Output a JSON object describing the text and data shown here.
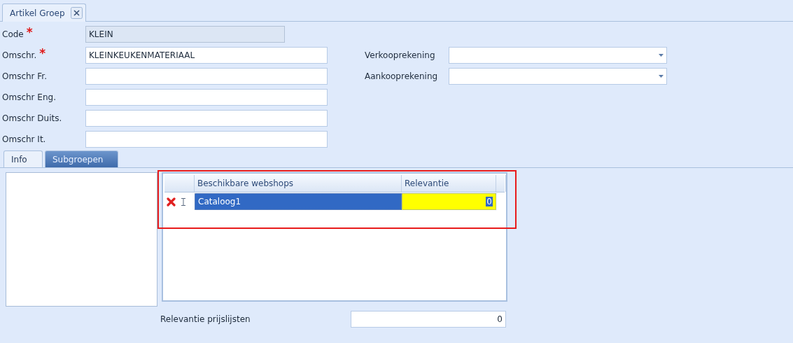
{
  "document_tab": {
    "title": "Artikel Groep",
    "selected": true
  },
  "fields": [
    {
      "label": "Code",
      "required_mark": "*",
      "value": "KLEIN",
      "disabled": true
    },
    {
      "label": "Omschr.",
      "required_mark": "*",
      "value": "KLEINKEUKENMATERIAAL",
      "disabled": false
    },
    {
      "label": "Omschr Fr.",
      "disabled": false
    },
    {
      "label": "Omschr Eng.",
      "disabled": false
    },
    {
      "label": "Omschr Duits.",
      "disabled": false
    },
    {
      "label": "Omschr It.",
      "disabled": false
    }
  ],
  "account_fields": [
    {
      "label": "Verkooprekening",
      "kind": "dropdown"
    },
    {
      "label": "Aankooprekening",
      "kind": "dropdown"
    }
  ],
  "tabs": [
    {
      "label": "Info",
      "selected": true
    },
    {
      "label": "Subgroepen",
      "selected": false
    }
  ],
  "grid": {
    "columns": [
      "Beschikbare webshops",
      "Relevantie"
    ],
    "rows": [
      {
        "selected": true,
        "cells": [
          {
            "text": "Cataloog1",
            "editing": false
          },
          {
            "text": "0",
            "editing": true
          }
        ]
      }
    ]
  },
  "relevance_field": {
    "label": "Relevantie prijslijsten",
    "value": "0"
  }
}
